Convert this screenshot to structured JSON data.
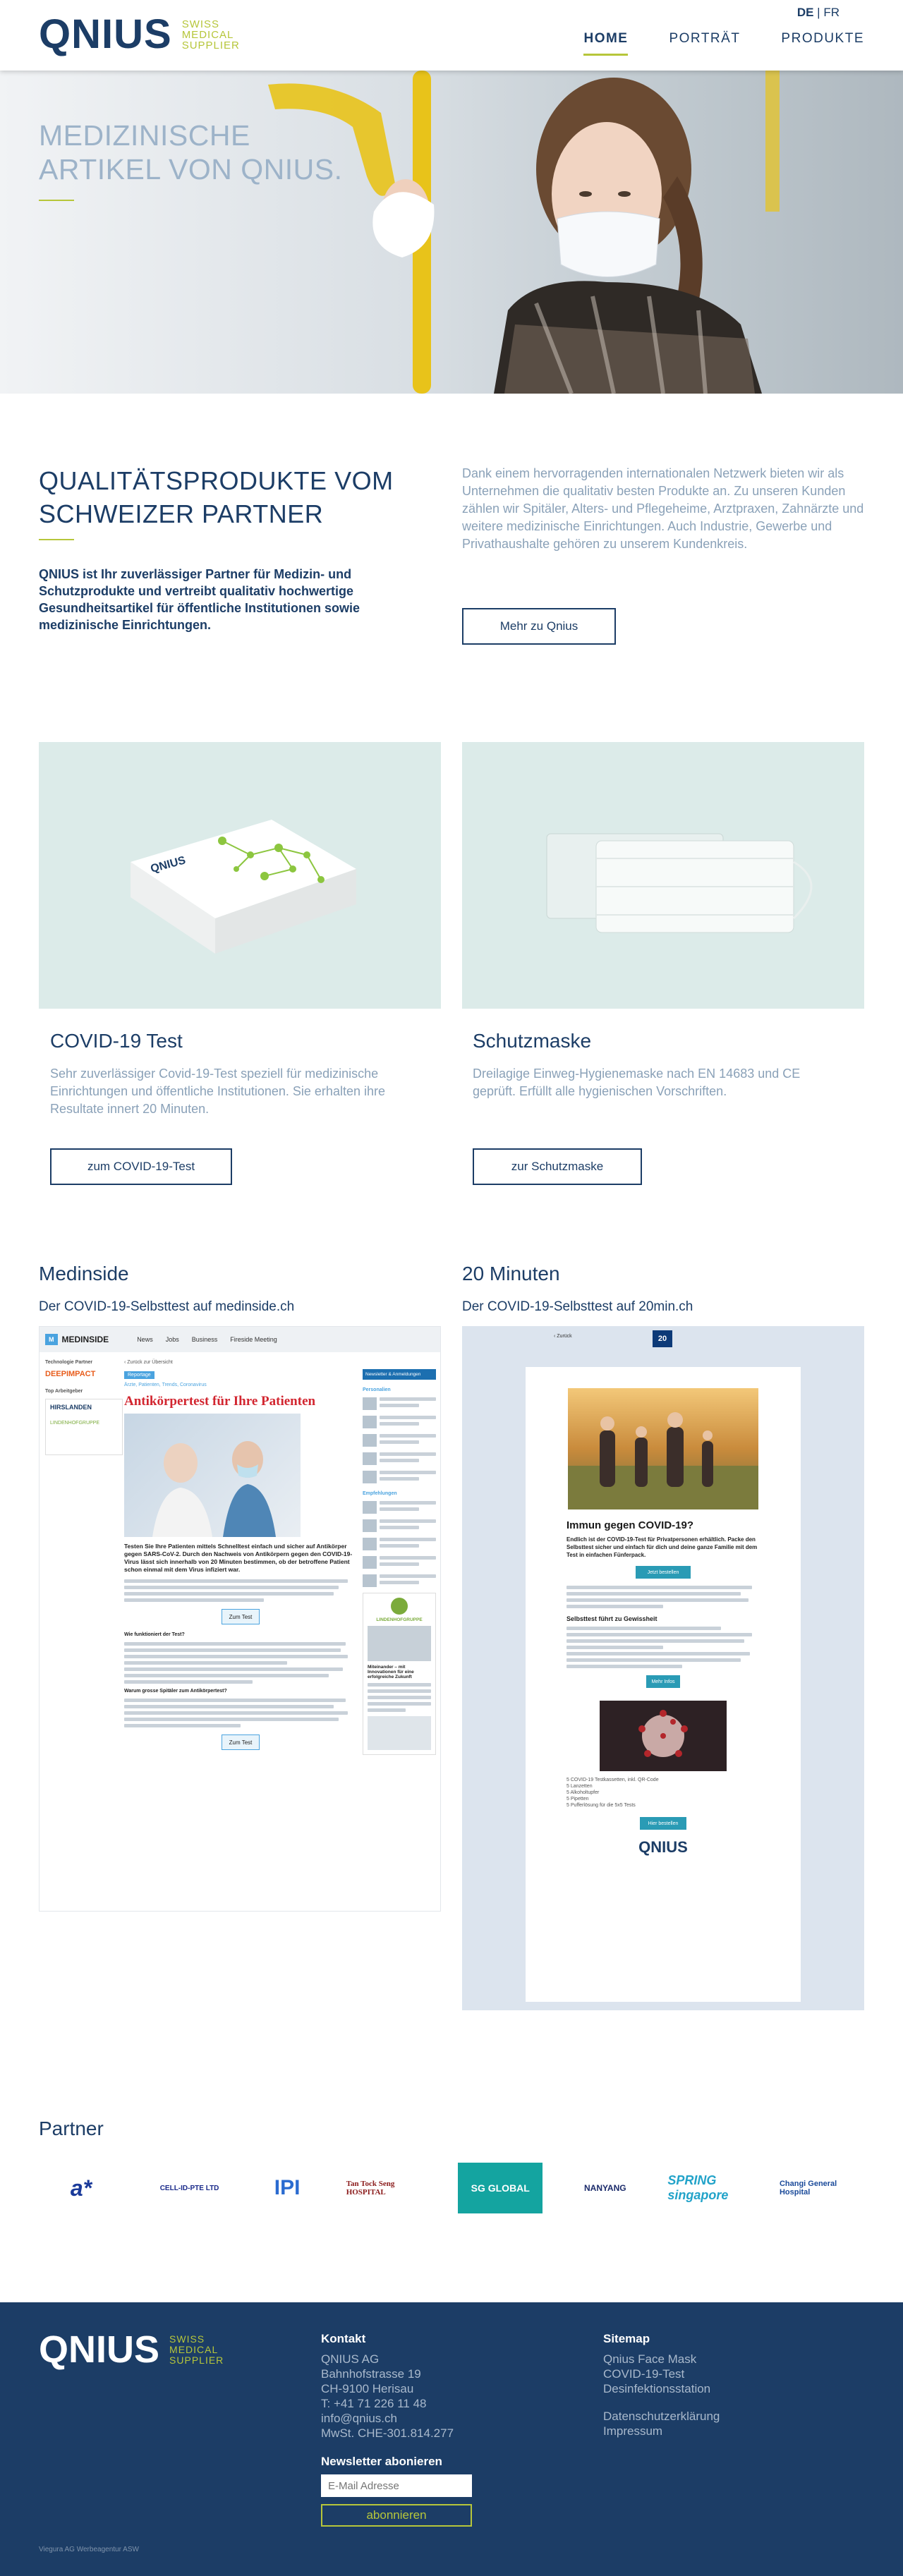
{
  "header": {
    "logo": "QNIUS",
    "logo_tagline": [
      "SWISS",
      "MEDICAL",
      "SUPPLIER"
    ],
    "lang_active": "DE",
    "lang_sep": "|",
    "lang_other": "FR",
    "nav": [
      {
        "label": "HOME",
        "active": true
      },
      {
        "label": "PORTRÄT",
        "active": false
      },
      {
        "label": "PRODUKTE",
        "active": false
      }
    ]
  },
  "hero": {
    "title_line1": "MEDIZINISCHE",
    "title_line2": "ARTIKEL VON QNIUS."
  },
  "intro": {
    "title_line1": "QUALITÄTSPRODUKTE VOM",
    "title_line2": "SCHWEIZER PARTNER",
    "bold_text": "QNIUS ist Ihr zuverlässiger Partner für Medizin- und Schutzprodukte und vertreibt qualitativ hochwertige Gesundheitsartikel für öffentliche Institutionen sowie medizinische Einrichtungen.",
    "text": "Dank einem hervorragenden internationalen Netzwerk bieten wir als Unternehmen die qualitativ besten Produkte an. Zu unseren Kunden zählen wir Spitäler, Alters- und Pflegeheime, Arztpraxen, Zahnärzte und weitere medizinische Einrichtungen. Auch Industrie, Gewerbe und Privathaushalte gehören zu unserem Kundenkreis.",
    "button": "Mehr zu Qnius"
  },
  "products": [
    {
      "title": "COVID-19 Test",
      "text": "Sehr zuverlässiger Covid-19-Test speziell für medizinische Einrichtungen und öffentliche Institutionen. Sie erhalten ihre Resultate innert 20 Minuten.",
      "button": "zum COVID-19-Test"
    },
    {
      "title": "Schutzmaske",
      "text": "Dreilagige Einweg-Hygienemaske nach EN 14683 und CE geprüft. Erfüllt alle hygienischen Vorschriften.",
      "button": "zur Schutzmaske"
    }
  ],
  "press": [
    {
      "title": "Medinside",
      "link": "Der COVID-19-Selbsttest auf medinside.ch"
    },
    {
      "title": "20 Minuten",
      "link": "Der COVID-19-Selbsttest auf 20min.ch"
    }
  ],
  "medinside_shot": {
    "logo": "MEDINSIDE",
    "nav": [
      "News",
      "Jobs",
      "Business",
      "Fireside Meeting"
    ],
    "back": "‹ Zurück zur Übersicht",
    "tag": "Reportage",
    "breadcrumb": "Ärzte, Patienten, Trends, Coronavirus",
    "headline": "Antikörpertest für Ihre Patienten",
    "lead": "Testen Sie Ihre Patienten mittels Schnelltest einfach und sicher auf Antikörper gegen SARS-CoV-2. Durch den Nachweis von Antikörpern gegen den COVID-19-Virus lässt sich innerhalb von 20 Minuten bestimmen, ob der betroffene Patient schon einmal mit dem Virus infiziert war.",
    "q1": "Wie funktioniert der Test?",
    "q2": "Warum grosse Spitäler zum Antikörpertest?",
    "button": "Zum Test",
    "sidebar_partner": "Technologie Partner",
    "sidebar_deep": "DEEPIMPACT",
    "sidebar_top": "Top Arbeitgeber",
    "sidebar_h1": "HIRSLANDEN",
    "sidebar_h2": "LINDENHOFGRUPPE",
    "right_head": "Newsletter & Anmeldungen",
    "right_sec1": "Personalien",
    "right_sec2": "Empfehlungen",
    "ad_brand": "LINDENHOFGRUPPE",
    "ad_text": "Miteinander – mit Innovationen für eine erfolgreiche Zukunft"
  },
  "min20_shot": {
    "back": "‹ Zurück",
    "logo": "20",
    "headline": "Immun gegen COVID-19?",
    "lead": "Endlich ist der COVID-19-Test für Privatpersonen erhältlich. Packe den Selbsttest sicher und einfach für dich und deine ganze Familie mit dem Test in einfachen Fünferpack.",
    "button1": "Jetzt bestellen",
    "section": "Selbsttest führt zu Gewissheit",
    "button2": "Mehr Infos",
    "list": [
      "5 COVID-19 Testkassetten, inkl. QR-Code",
      "5 Lanzetten",
      "5 Alkoholtupfer",
      "5 Pipetten",
      "5 Pufferlösung für die 5x5 Tests"
    ],
    "button3": "Hier bestellen",
    "logo_footer": "QNIUS"
  },
  "partners": {
    "title": "Partner",
    "logos": [
      "a*",
      "CELL-ID-PTE LTD",
      "IPI",
      "Tan Tock Seng HOSPITAL",
      "SG GLOBAL",
      "NANYANG",
      "SPRING singapore",
      "Changi General Hospital"
    ]
  },
  "footer": {
    "logo": "QNIUS",
    "logo_tagline": [
      "SWISS",
      "MEDICAL",
      "SUPPLIER"
    ],
    "contact_head": "Kontakt",
    "contact_lines": [
      "QNIUS AG",
      "Bahnhofstrasse 19",
      "CH-9100 Herisau",
      "T: +41 71 226 11 48",
      "info@qnius.ch",
      "MwSt. CHE-301.814.277"
    ],
    "newsletter_head": "Newsletter abonieren",
    "newsletter_placeholder": "E-Mail Adresse",
    "newsletter_button": "abonnieren",
    "sitemap_head": "Sitemap",
    "sitemap_links": [
      "Qnius Face Mask",
      "COVID-19-Test",
      "Desinfektionsstation"
    ],
    "legal_links": [
      "Datenschutzerklärung",
      "Impressum"
    ],
    "credit": "Viegura AG Werbeagentur ASW"
  },
  "colors": {
    "navy": "#1c3d66",
    "green": "#b6c63a",
    "lightblue": "#8aa1b8"
  }
}
